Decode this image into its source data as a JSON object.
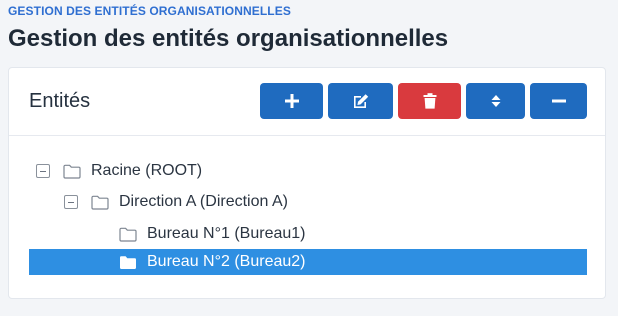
{
  "breadcrumb": "GESTION DES ENTITÉS ORGANISATIONNELLES",
  "page_title": "Gestion des entités organisationnelles",
  "card": {
    "title": "Entités",
    "buttons": [
      {
        "name": "add",
        "icon": "plus-icon",
        "color": "#1f6bbf"
      },
      {
        "name": "edit",
        "icon": "edit-icon",
        "color": "#1f6bbf"
      },
      {
        "name": "delete",
        "icon": "trash-icon",
        "color": "#d93a3e"
      },
      {
        "name": "expand",
        "icon": "sort-icon",
        "color": "#1f6bbf"
      },
      {
        "name": "collapse",
        "icon": "minus-icon",
        "color": "#1f6bbf"
      }
    ]
  },
  "tree": {
    "nodes": [
      {
        "label": "Racine (ROOT)",
        "level": 0,
        "expanded": true,
        "selected": false
      },
      {
        "label": "Direction A (Direction A)",
        "level": 1,
        "expanded": true,
        "selected": false
      },
      {
        "label": "Bureau N°1 (Bureau1)",
        "level": 2,
        "expanded": null,
        "selected": false
      },
      {
        "label": "Bureau N°2 (Bureau2)",
        "level": 2,
        "expanded": null,
        "selected": true
      }
    ],
    "selected_color": "#2e8fe2"
  }
}
